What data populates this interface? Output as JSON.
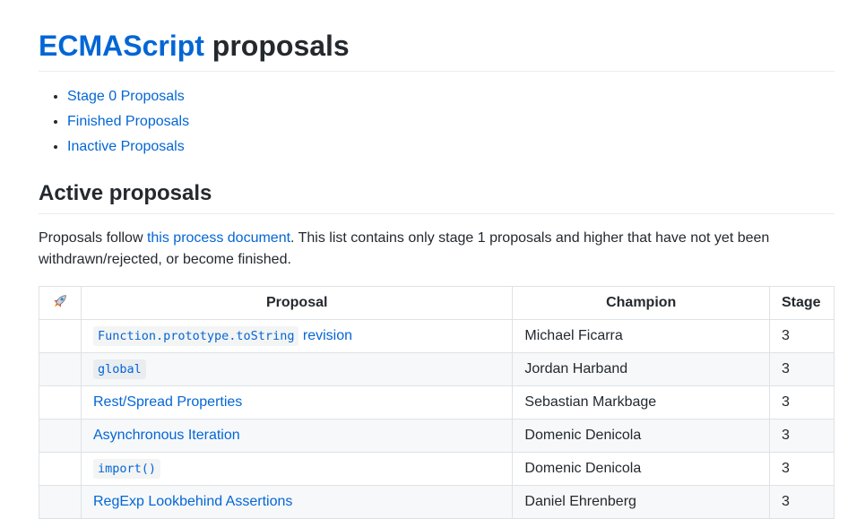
{
  "header": {
    "title_link": "ECMAScript",
    "title_rest": " proposals"
  },
  "toc": [
    {
      "label": "Stage 0 Proposals"
    },
    {
      "label": "Finished Proposals"
    },
    {
      "label": "Inactive Proposals"
    }
  ],
  "section": {
    "title": "Active proposals",
    "intro_before": "Proposals follow ",
    "intro_link": "this process document",
    "intro_after": ". This list contains only stage 1 proposals and higher that have not yet been withdrawn/rejected, or become finished."
  },
  "table": {
    "header_icon": "rocket-icon",
    "headers": {
      "proposal": "Proposal",
      "champion": "Champion",
      "stage": "Stage"
    },
    "rows": [
      {
        "code": "Function.prototype.toString",
        "text": " revision",
        "champion": "Michael Ficarra",
        "stage": "3"
      },
      {
        "code": "global",
        "text": "",
        "champion": "Jordan Harband",
        "stage": "3"
      },
      {
        "code": "",
        "text": "Rest/Spread Properties",
        "champion": "Sebastian Markbage",
        "stage": "3"
      },
      {
        "code": "",
        "text": "Asynchronous Iteration",
        "champion": "Domenic Denicola",
        "stage": "3"
      },
      {
        "code": "import()",
        "text": "",
        "champion": "Domenic Denicola",
        "stage": "3"
      },
      {
        "code": "",
        "text": "RegExp Lookbehind Assertions",
        "champion": "Daniel Ehrenberg",
        "stage": "3"
      }
    ]
  },
  "colors": {
    "link": "#0366d6",
    "text": "#24292e",
    "border": "#dfe2e5",
    "row_alt": "#f6f8fa"
  }
}
